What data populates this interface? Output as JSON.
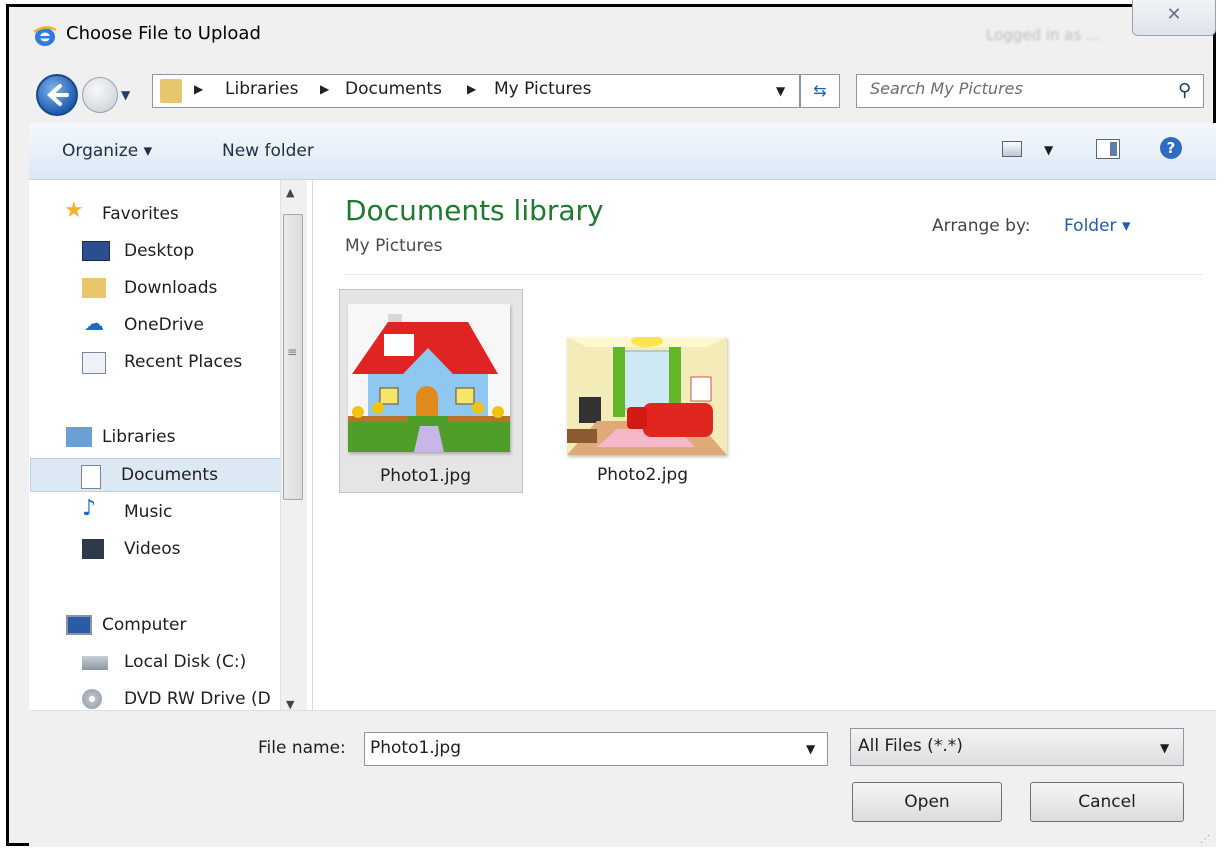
{
  "window": {
    "title": "Choose File to Upload",
    "close_symbol": "✕",
    "ghost_text": "Logged in as ..."
  },
  "address": {
    "breadcrumbs": [
      "Libraries",
      "Documents",
      "My Pictures"
    ],
    "search_placeholder": "Search My Pictures"
  },
  "toolbar": {
    "organize_label": "Organize ▾",
    "new_folder_label": "New folder"
  },
  "nav": {
    "favorites": "Favorites",
    "desktop": "Desktop",
    "downloads": "Downloads",
    "onedrive": "OneDrive",
    "recent": "Recent Places",
    "libraries": "Libraries",
    "documents": "Documents",
    "music": "Music",
    "videos": "Videos",
    "computer": "Computer",
    "local_disk": "Local Disk (C:)",
    "dvd": "DVD RW Drive (D"
  },
  "content": {
    "library_title": "Documents library",
    "library_subtitle": "My Pictures",
    "arrange_label": "Arrange by:",
    "arrange_value": "Folder ▾",
    "files": [
      "Photo1.jpg",
      "Photo2.jpg"
    ]
  },
  "footer": {
    "file_name_label": "File name:",
    "file_name_value": "Photo1.jpg",
    "filter_value": "All Files (*.*)",
    "open_label": "Open",
    "cancel_label": "Cancel"
  },
  "colors": {
    "accent_blue": "#1e5eb1",
    "library_green": "#1e7a2e",
    "selection": "#dde8f5"
  }
}
